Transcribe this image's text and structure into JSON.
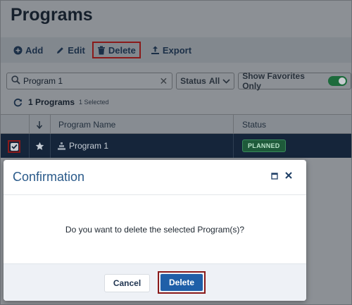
{
  "page": {
    "title": "Programs"
  },
  "toolbar": {
    "add_label": "Add",
    "edit_label": "Edit",
    "delete_label": "Delete",
    "export_label": "Export"
  },
  "filters": {
    "search_value": "Program 1",
    "status_label": "Status",
    "status_value": "All",
    "favorites_label": "Show Favorites Only",
    "favorites_on": true
  },
  "summary": {
    "count_text": "1 Programs",
    "selected_text": "1 Selected"
  },
  "table": {
    "columns": [
      "Program Name",
      "Status"
    ],
    "rows": [
      {
        "name": "Program 1",
        "status": "PLANNED",
        "selected": true
      }
    ]
  },
  "dialog": {
    "title": "Confirmation",
    "message": "Do you want to delete the selected Program(s)?",
    "cancel_label": "Cancel",
    "confirm_label": "Delete"
  },
  "colors": {
    "accent": "#1f5fa8",
    "title_blue": "#2a5a8a",
    "highlight_red": "#8a1a1a",
    "status_planned": "#1e5a3a",
    "selected_row": "#15253a"
  },
  "icons": [
    "plus-circle-icon",
    "pencil-icon",
    "trash-icon",
    "export-icon",
    "search-icon",
    "clear-icon",
    "chevron-down-icon",
    "refresh-icon",
    "sort-arrow-icon",
    "star-icon",
    "program-icon",
    "check-icon",
    "maximize-icon",
    "close-icon"
  ]
}
